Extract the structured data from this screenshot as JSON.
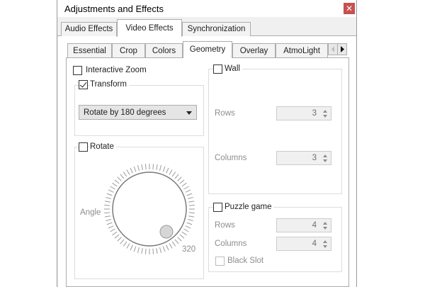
{
  "window": {
    "title": "Adjustments and Effects",
    "close_glyph": "✕"
  },
  "main_tabs": [
    {
      "label": "Audio Effects"
    },
    {
      "label": "Video Effects"
    },
    {
      "label": "Synchronization"
    }
  ],
  "sub_tabs": [
    {
      "label": "Essential"
    },
    {
      "label": "Crop"
    },
    {
      "label": "Colors"
    },
    {
      "label": "Geometry"
    },
    {
      "label": "Overlay"
    },
    {
      "label": "AtmoLight"
    }
  ],
  "geometry": {
    "interactive_zoom": {
      "label": "Interactive Zoom",
      "checked": false
    },
    "transform": {
      "label": "Transform",
      "checked": true,
      "selected": "Rotate by 180 degrees"
    },
    "rotate": {
      "label": "Rotate",
      "checked": false,
      "angle_label": "Angle",
      "angle_value": "320"
    },
    "wall": {
      "label": "Wall",
      "checked": false,
      "rows_label": "Rows",
      "rows_value": "3",
      "columns_label": "Columns",
      "columns_value": "3"
    },
    "puzzle": {
      "label": "Puzzle game",
      "checked": false,
      "rows_label": "Rows",
      "rows_value": "4",
      "columns_label": "Columns",
      "columns_value": "4",
      "black_slot_label": "Black Slot"
    }
  }
}
